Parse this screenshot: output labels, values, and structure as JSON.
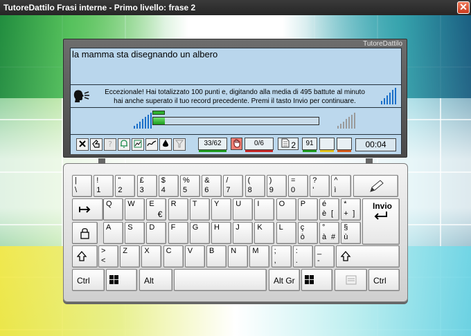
{
  "window": {
    "title": "TutoreDattilo Frasi interne - Primo livello: frase 2",
    "close_label": "✕"
  },
  "screen": {
    "brand": "TutoreDattilo",
    "phrase": "la mamma sta disegnando un albero",
    "message_line1": "Eccezionale! Hai totalizzato 100 punti e, digitando alla media di 495 battute al minuto",
    "message_line2": "hai anche superato il tuo record precedente. Premi il tasto Invio per continuare.",
    "progress_fraction": 0.07
  },
  "status": {
    "buttons": [
      "close-x",
      "hand-pointer",
      "help",
      "bell",
      "chart",
      "graph",
      "ink-drop",
      "funnel"
    ],
    "characters": "33/62",
    "errors": "0/6",
    "page": "2",
    "score": "91",
    "timer": "00:04",
    "colors": {
      "green": "#1e9c1e",
      "red": "#c62828",
      "yellow": "#e2c21a",
      "orange": "#d65a1a"
    }
  },
  "keyboard": {
    "row1": [
      {
        "t": "|",
        "b": "\\"
      },
      {
        "t": "!",
        "b": "1"
      },
      {
        "t": "\"",
        "b": "2"
      },
      {
        "t": "£",
        "b": "3"
      },
      {
        "t": "$",
        "b": "4"
      },
      {
        "t": "%",
        "b": "5"
      },
      {
        "t": "&",
        "b": "6"
      },
      {
        "t": "/",
        "b": "7"
      },
      {
        "t": "(",
        "b": "8"
      },
      {
        "t": ")",
        "b": "9"
      },
      {
        "t": "=",
        "b": "0"
      },
      {
        "t": "?",
        "b": "'"
      },
      {
        "t": "^",
        "b": "ì"
      }
    ],
    "row2": [
      {
        "t": "Q"
      },
      {
        "t": "W"
      },
      {
        "t": "E",
        "br": "€"
      },
      {
        "t": "R"
      },
      {
        "t": "T"
      },
      {
        "t": "Y"
      },
      {
        "t": "U"
      },
      {
        "t": "I"
      },
      {
        "t": "O"
      },
      {
        "t": "P"
      },
      {
        "t": "é",
        "b": "è",
        "b2": "["
      },
      {
        "t": "*",
        "b": "+",
        "b2": "]"
      }
    ],
    "enter_label": "Invio",
    "row3": [
      {
        "t": "A"
      },
      {
        "t": "S"
      },
      {
        "t": "D"
      },
      {
        "t": "F"
      },
      {
        "t": "G"
      },
      {
        "t": "H"
      },
      {
        "t": "J"
      },
      {
        "t": "K"
      },
      {
        "t": "L"
      },
      {
        "t": "ç",
        "b": "ò"
      },
      {
        "t": "°",
        "b": "à",
        "b2": "#"
      },
      {
        "t": "§",
        "b": "ù"
      }
    ],
    "row4": [
      {
        "t": ">",
        "b": "<"
      },
      {
        "t": "Z"
      },
      {
        "t": "X"
      },
      {
        "t": "C"
      },
      {
        "t": "V"
      },
      {
        "t": "B"
      },
      {
        "t": "N"
      },
      {
        "t": "M"
      },
      {
        "t": ";",
        "b": ","
      },
      {
        "t": ":",
        "b": "."
      },
      {
        "t": "_",
        "b": "-"
      }
    ],
    "ctrl_left": "Ctrl",
    "alt": "Alt",
    "altgr": "Alt Gr",
    "ctrl_right": "Ctrl"
  }
}
